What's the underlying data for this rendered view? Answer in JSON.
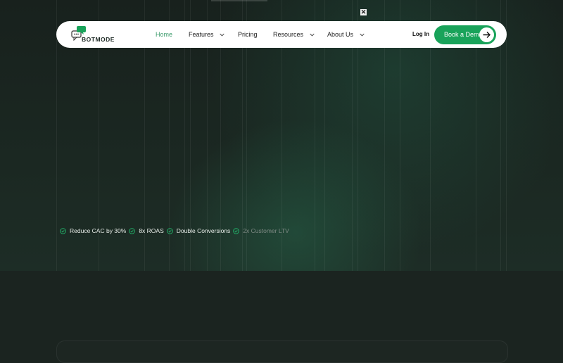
{
  "brand": {
    "logo_text": "BOTMODE",
    "accent_color": "#19a35a"
  },
  "nav": {
    "items": [
      {
        "label": "Home",
        "active": true,
        "has_dropdown": false
      },
      {
        "label": "Features",
        "active": false,
        "has_dropdown": true
      },
      {
        "label": "Pricing",
        "active": false,
        "has_dropdown": false
      },
      {
        "label": "Resources",
        "active": false,
        "has_dropdown": true
      },
      {
        "label": "About Us",
        "active": false,
        "has_dropdown": true
      }
    ],
    "login_label": "Log In",
    "cta_label": "Book a Demo",
    "cta_icon": "arrow-right-icon",
    "dropdown_icon": "chevron-down-icon"
  },
  "banner": {
    "close_icon": "close-icon",
    "close_glyph": "✕"
  },
  "benefits": [
    {
      "label": "Reduce CAC by 30%",
      "icon": "check-circle-icon"
    },
    {
      "label": "8x ROAS",
      "icon": "check-circle-icon"
    },
    {
      "label": "Double Conversions",
      "icon": "check-circle-icon"
    },
    {
      "label": "2x Customer LTV",
      "icon": "check-circle-icon"
    }
  ]
}
